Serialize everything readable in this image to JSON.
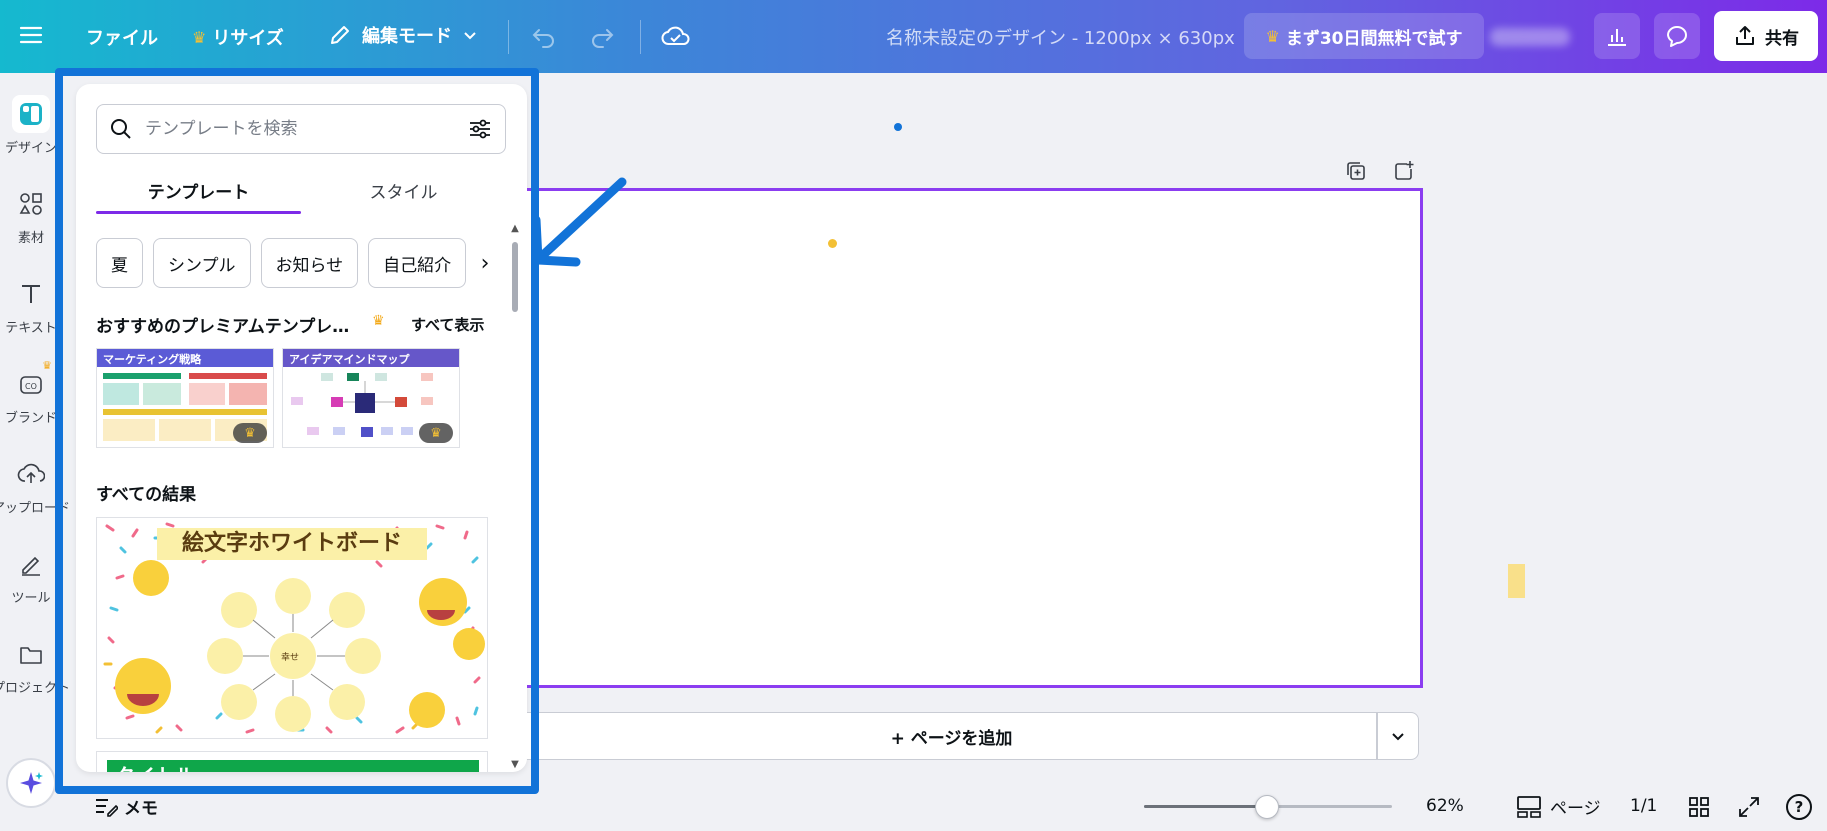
{
  "colors": {
    "accent": "#7d2ae8",
    "annotation": "#1273d8",
    "premium": "#f3a816"
  },
  "topbar": {
    "menu_icon": "hamburger-menu-icon",
    "file_label": "ファイル",
    "resize_label": "リサイズ",
    "edit_mode_label": "編集モード",
    "doc_title": "名称未設定のデザイン - 1200px × 630px",
    "trial_label": "まず30日間無料で試す",
    "share_label": "共有"
  },
  "rail": {
    "items": [
      {
        "label": "デザイン",
        "icon": "design-icon"
      },
      {
        "label": "素材",
        "icon": "elements-icon"
      },
      {
        "label": "テキスト",
        "icon": "text-icon"
      },
      {
        "label": "ブランド",
        "icon": "brand-icon"
      },
      {
        "label": "アップロード",
        "icon": "upload-icon"
      },
      {
        "label": "ツール",
        "icon": "tools-icon"
      },
      {
        "label": "プロジェクト",
        "icon": "projects-icon"
      }
    ]
  },
  "panel": {
    "search_placeholder": "テンプレートを検索",
    "tabs": [
      {
        "label": "テンプレート"
      },
      {
        "label": "スタイル"
      }
    ],
    "chips": [
      {
        "label": "夏"
      },
      {
        "label": "シンプル"
      },
      {
        "label": "お知らせ"
      },
      {
        "label": "自己紹介"
      }
    ],
    "premium_section_title": "おすすめのプレミアムテンプレ…",
    "see_all_label": "すべて表示",
    "premium_templates": [
      {
        "title": "マーケティング戦略",
        "head_color": "#5b5bd6"
      },
      {
        "title": "アイデアマインドマップ",
        "head_color": "#6657c9"
      }
    ],
    "all_results_title": "すべての結果",
    "big_template_title": "絵文字ホワイトボード",
    "big_template_center": "幸せ",
    "next_template_title": "タイトル"
  },
  "canvas": {
    "add_page_label": "+ ページを追加"
  },
  "bottombar": {
    "memo_label": "メモ",
    "zoom_value": 62,
    "zoom_label": "62%",
    "pages_label": "ページ",
    "page_count": "1/1",
    "help_label": "?"
  }
}
